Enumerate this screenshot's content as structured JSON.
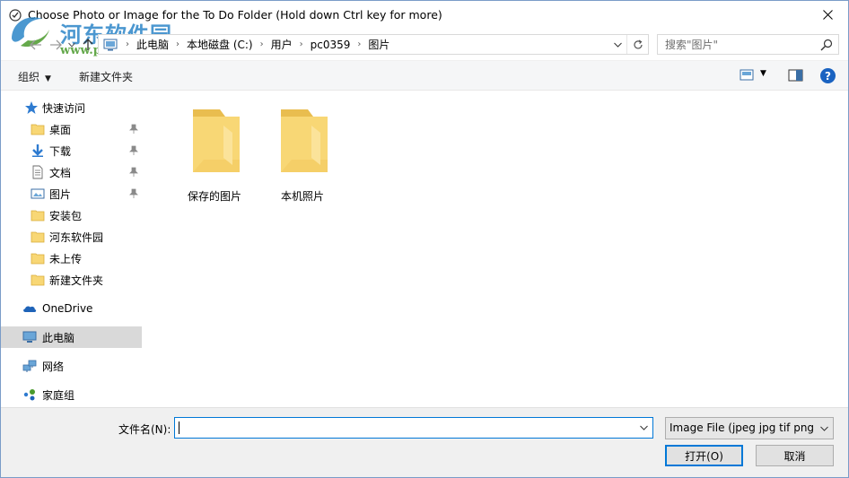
{
  "window": {
    "title": "Choose Photo or Image for the To Do Folder  (Hold down Ctrl key for more)",
    "close_glyph": "✕"
  },
  "watermark": {
    "text": "河东软件园",
    "url": "www.pc0359.cn"
  },
  "address": {
    "crumbs": [
      "此电脑",
      "本地磁盘 (C:)",
      "用户",
      "pc0359",
      "图片"
    ],
    "search_placeholder": "搜索\"图片\""
  },
  "toolbar": {
    "organize_label": "组织",
    "new_folder_label": "新建文件夹",
    "help_label": "?"
  },
  "sidebar": {
    "quick_access": "快速访问",
    "quick_items": [
      {
        "label": "桌面",
        "icon": "desktop-folder-icon",
        "pinned": true
      },
      {
        "label": "下载",
        "icon": "download-arrow-icon",
        "pinned": true
      },
      {
        "label": "文档",
        "icon": "document-icon",
        "pinned": true
      },
      {
        "label": "图片",
        "icon": "pictures-icon",
        "pinned": true
      },
      {
        "label": "安装包",
        "icon": "folder-icon",
        "pinned": false
      },
      {
        "label": "河东软件园",
        "icon": "folder-icon",
        "pinned": false
      },
      {
        "label": "未上传",
        "icon": "folder-icon",
        "pinned": false
      },
      {
        "label": "新建文件夹",
        "icon": "folder-icon",
        "pinned": false
      }
    ],
    "onedrive": "OneDrive",
    "this_pc": "此电脑",
    "network": "网络",
    "homegroup": "家庭组"
  },
  "content": {
    "folders": [
      {
        "name": "保存的图片"
      },
      {
        "name": "本机照片"
      }
    ]
  },
  "bottom": {
    "filename_label": "文件名(N):",
    "filename_value": "",
    "filetype_value": "Image File  (jpeg jpg tif png",
    "open_label": "打开(O)",
    "cancel_label": "取消"
  },
  "colors": {
    "accent": "#0078d7",
    "folder": "#f8d775",
    "selected_bg": "#d9d9d9"
  }
}
